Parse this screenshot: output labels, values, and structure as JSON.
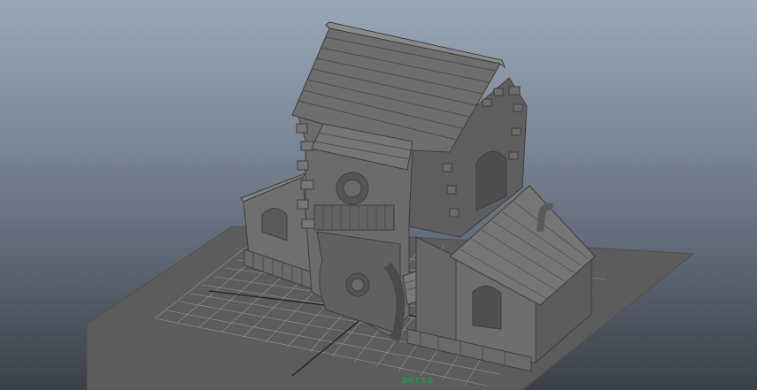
{
  "viewport": {
    "camera_label": "persp"
  },
  "colors": {
    "background_top": "#9aa7b6",
    "background_bottom": "#3c4048",
    "ground": "#5b5b5b",
    "grid_lines": "#aaaaaa",
    "model_shading": "#6b6b6b",
    "camera_label": "#1aa14a"
  }
}
